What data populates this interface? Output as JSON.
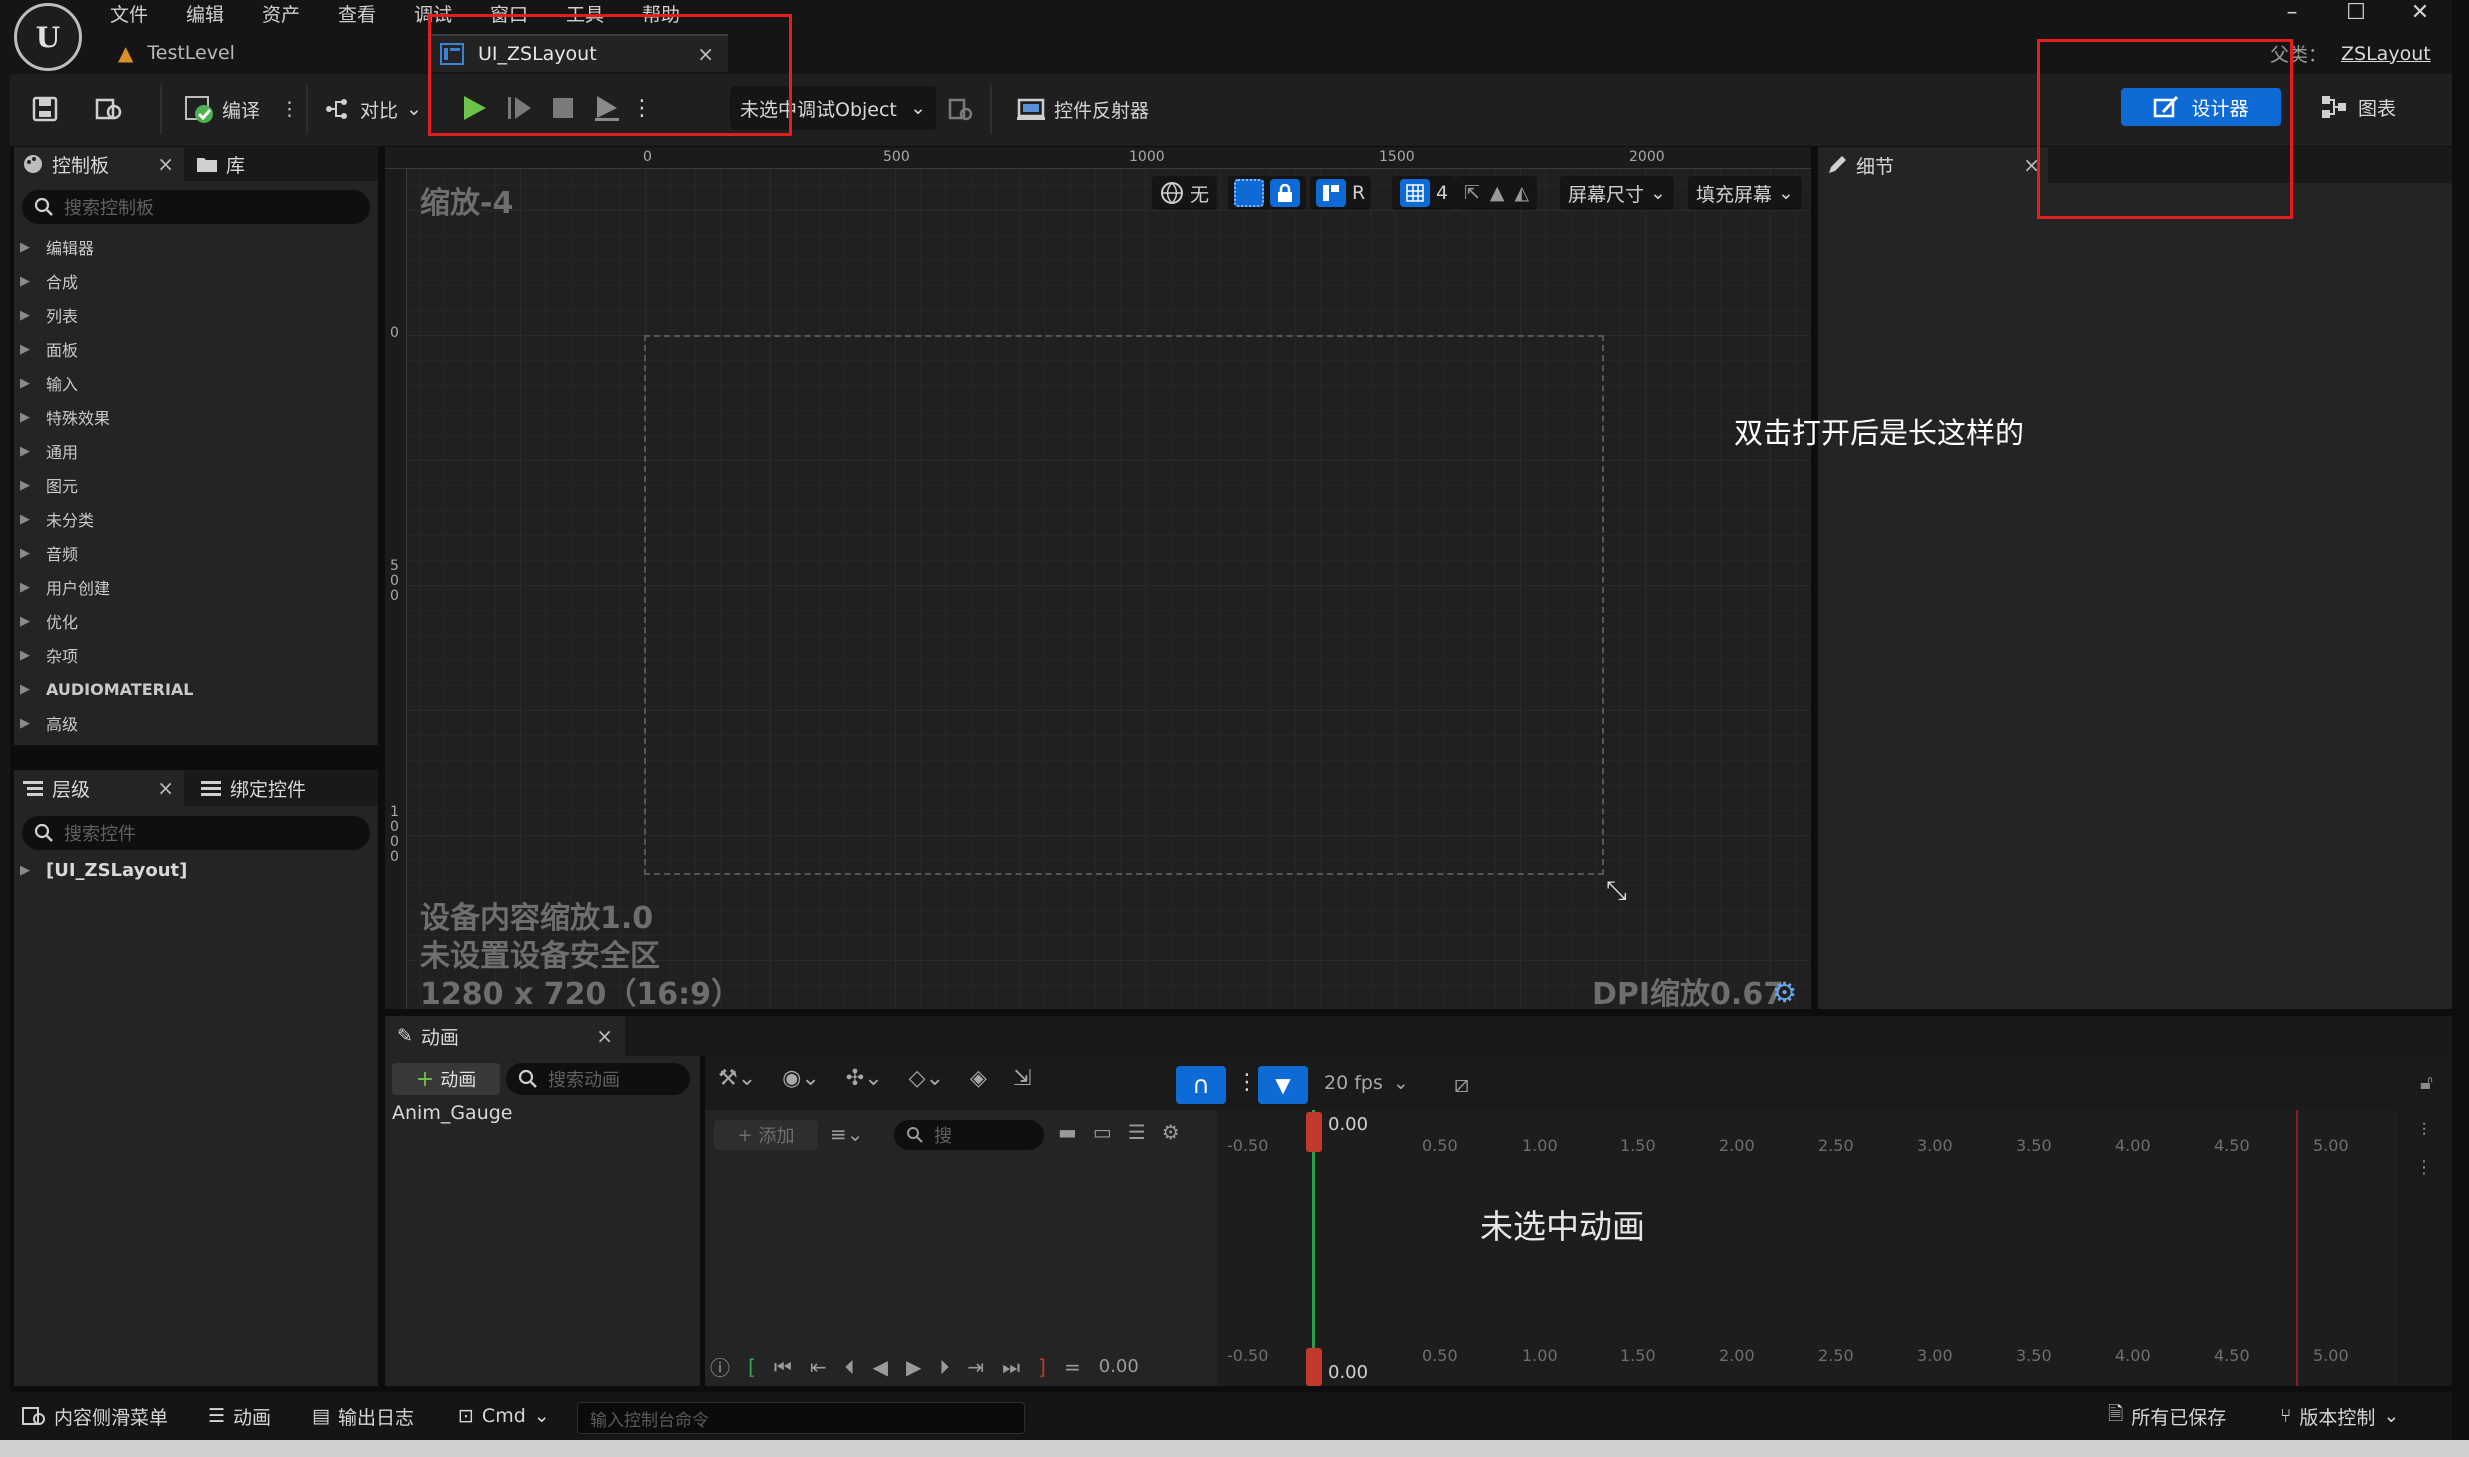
{
  "menu": [
    "文件",
    "编辑",
    "资产",
    "查看",
    "调试",
    "窗口",
    "工具",
    "帮助"
  ],
  "tabs": {
    "level_tab": "TestLevel",
    "asset_tab": "UI_ZSLayout",
    "close": "×"
  },
  "parent_class": {
    "label": "父类：",
    "value": "ZSLayout"
  },
  "toolbar": {
    "compile": "编译",
    "diff": "对比",
    "debug_object": "未选中调试Object",
    "widget_reflector": "控件反射器",
    "designer": "设计器",
    "graph": "图表"
  },
  "palette": {
    "tab_palette": "控制板",
    "tab_library": "库",
    "search_placeholder": "搜索控制板",
    "categories": [
      "编辑器",
      "合成",
      "列表",
      "面板",
      "输入",
      "特殊效果",
      "通用",
      "图元",
      "未分类",
      "音频",
      "用户创建",
      "优化",
      "杂项",
      "AUDIOMATERIAL",
      "高级"
    ]
  },
  "hierarchy": {
    "tab_hierarchy": "层级",
    "tab_bind": "绑定控件",
    "search_placeholder": "搜索控件",
    "root": "[UI_ZSLayout]"
  },
  "viewport": {
    "zoom": "缩放-4",
    "ruler_top": [
      "0",
      "500",
      "1000",
      "1500",
      "2000"
    ],
    "ruler_left": [
      "0",
      "5\n0\n0",
      "1\n0\n0\n0"
    ],
    "chip_none": "无",
    "chip_r": "R",
    "chip_grid": "4",
    "screen_size": "屏幕尺寸",
    "fill_screen": "填充屏幕",
    "device_scale": "设备内容缩放1.0",
    "safe_zone": "未设置设备安全区",
    "resolution": "1280 x 720（16:9）",
    "dpi": "DPI缩放0.67"
  },
  "annotation": "双击打开后是长这样的",
  "details": {
    "tab": "细节"
  },
  "animation": {
    "tab": "动画",
    "add_button": "动画",
    "search_placeholder": "搜索动画",
    "items": [
      "Anim_Gauge"
    ],
    "fps": "20 fps",
    "add_track": "添加",
    "track_search": "搜",
    "current_time": "0.00",
    "time_field": "0.00",
    "not_selected": "未选中动画",
    "time_labels": [
      "-0.50",
      "0.50",
      "1.00",
      "1.50",
      "2.00",
      "2.50",
      "3.00",
      "3.50",
      "4.00",
      "4.50",
      "5.00"
    ]
  },
  "bottombar": {
    "content_drawer": "内容侧滑菜单",
    "animation": "动画",
    "output_log": "输出日志",
    "cmd": "Cmd",
    "cmd_placeholder": "输入控制台命令",
    "all_saved": "所有已保存",
    "source_control": "版本控制"
  },
  "colors": {
    "accent": "#0e6bd6",
    "annotation_box": "#e21e1e",
    "play": "#6cc34a"
  }
}
